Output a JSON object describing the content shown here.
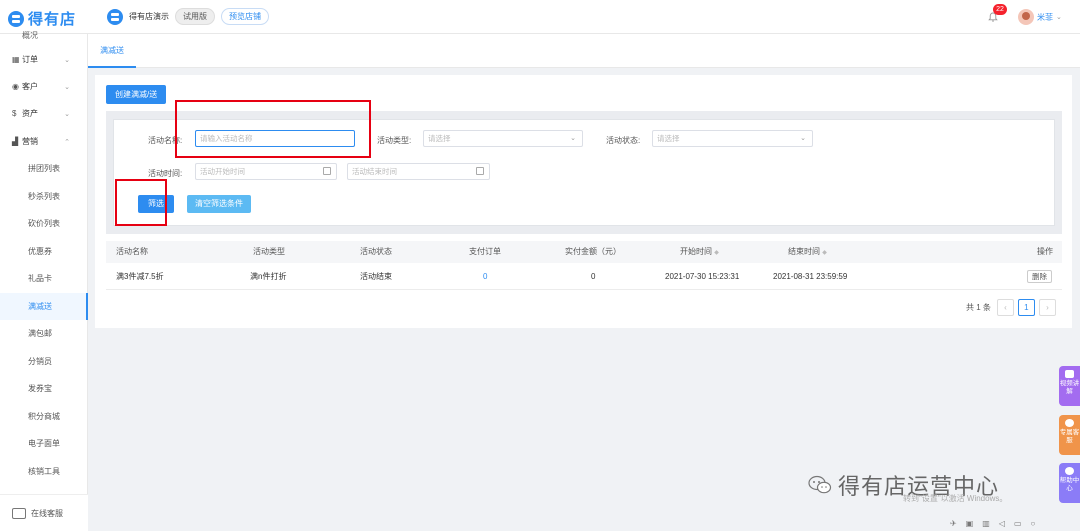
{
  "app": {
    "logo_text": "得有店",
    "shop_name": "得有店演示",
    "trial_tag": "试用版",
    "preview_tag": "预览店铺",
    "notification_count": "22",
    "user_name": "米菲"
  },
  "sidebar": {
    "partial_top": "概况",
    "groups": [
      {
        "label": "订单",
        "icon": "list-icon"
      },
      {
        "label": "客户",
        "icon": "eye-icon"
      },
      {
        "label": "资产",
        "icon": "dollar-icon"
      },
      {
        "label": "营销",
        "icon": "chart-icon"
      }
    ],
    "items": [
      "拼团列表",
      "秒杀列表",
      "砍价列表",
      "优惠券",
      "礼品卡",
      "满减送",
      "满包邮",
      "分销员",
      "发券宝",
      "积分商城",
      "电子面单",
      "核销工具"
    ],
    "active_item": "满减送",
    "service_label": "在线客服"
  },
  "tabs": {
    "active": "满减送"
  },
  "toolbar": {
    "create_label": "创建满减/送"
  },
  "filter": {
    "name_label": "活动名称:",
    "name_placeholder": "请输入活动名称",
    "type_label": "活动类型:",
    "type_placeholder": "请选择",
    "status_label": "活动状态:",
    "status_placeholder": "请选择",
    "time_label": "活动时间:",
    "start_placeholder": "活动开始时间",
    "end_placeholder": "活动结束时间",
    "filter_button": "筛选",
    "clear_button": "清空筛选条件"
  },
  "table": {
    "headers": [
      "活动名称",
      "活动类型",
      "活动状态",
      "支付订单",
      "实付金额（元）",
      "开始时间",
      "结束时间",
      "操作"
    ],
    "rows": [
      {
        "name": "满3件减7.5折",
        "type": "满n件打折",
        "status": "活动结束",
        "orders": "0",
        "amount": "0",
        "start": "2021-07-30 15:23:31",
        "end": "2021-08-31 23:59:59",
        "action": "删除"
      }
    ]
  },
  "pager": {
    "total": "共 1 条",
    "current_page": "1"
  },
  "float_widgets": {
    "video": "视频讲解",
    "service": "专属客服",
    "help": "帮助中心"
  },
  "watermark": {
    "text": "得有店运营中心",
    "windows_hint": "转到\"设置\"以激活 Windows。"
  },
  "colors": {
    "primary": "#2d8cf0",
    "highlight_box": "#e60012"
  }
}
